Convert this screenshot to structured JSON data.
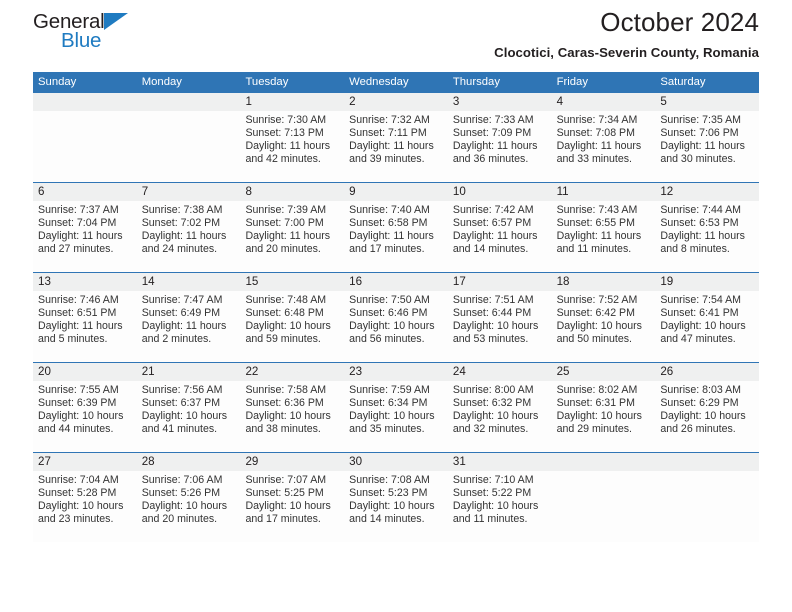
{
  "logo": {
    "text_top": "General",
    "text_bottom": "Blue",
    "color_dark": "#231f20",
    "color_blue": "#1f7bc1"
  },
  "header": {
    "title": "October 2024",
    "subtitle": "Clocotici, Caras-Severin County, Romania"
  },
  "theme": {
    "header_blue": "#2f75b5",
    "date_band": "#eff0f0",
    "cell_bg": "#fdfdfd",
    "text": "#231f20"
  },
  "weekdays": [
    "Sunday",
    "Monday",
    "Tuesday",
    "Wednesday",
    "Thursday",
    "Friday",
    "Saturday"
  ],
  "labels": {
    "sunrise": "Sunrise:",
    "sunset": "Sunset:",
    "daylight": "Daylight:"
  },
  "weeks": [
    [
      {
        "day": "",
        "lines": []
      },
      {
        "day": "",
        "lines": []
      },
      {
        "day": "1",
        "lines": [
          "Sunrise: 7:30 AM",
          "Sunset: 7:13 PM",
          "Daylight: 11 hours",
          "and 42 minutes."
        ]
      },
      {
        "day": "2",
        "lines": [
          "Sunrise: 7:32 AM",
          "Sunset: 7:11 PM",
          "Daylight: 11 hours",
          "and 39 minutes."
        ]
      },
      {
        "day": "3",
        "lines": [
          "Sunrise: 7:33 AM",
          "Sunset: 7:09 PM",
          "Daylight: 11 hours",
          "and 36 minutes."
        ]
      },
      {
        "day": "4",
        "lines": [
          "Sunrise: 7:34 AM",
          "Sunset: 7:08 PM",
          "Daylight: 11 hours",
          "and 33 minutes."
        ]
      },
      {
        "day": "5",
        "lines": [
          "Sunrise: 7:35 AM",
          "Sunset: 7:06 PM",
          "Daylight: 11 hours",
          "and 30 minutes."
        ]
      }
    ],
    [
      {
        "day": "6",
        "lines": [
          "Sunrise: 7:37 AM",
          "Sunset: 7:04 PM",
          "Daylight: 11 hours",
          "and 27 minutes."
        ]
      },
      {
        "day": "7",
        "lines": [
          "Sunrise: 7:38 AM",
          "Sunset: 7:02 PM",
          "Daylight: 11 hours",
          "and 24 minutes."
        ]
      },
      {
        "day": "8",
        "lines": [
          "Sunrise: 7:39 AM",
          "Sunset: 7:00 PM",
          "Daylight: 11 hours",
          "and 20 minutes."
        ]
      },
      {
        "day": "9",
        "lines": [
          "Sunrise: 7:40 AM",
          "Sunset: 6:58 PM",
          "Daylight: 11 hours",
          "and 17 minutes."
        ]
      },
      {
        "day": "10",
        "lines": [
          "Sunrise: 7:42 AM",
          "Sunset: 6:57 PM",
          "Daylight: 11 hours",
          "and 14 minutes."
        ]
      },
      {
        "day": "11",
        "lines": [
          "Sunrise: 7:43 AM",
          "Sunset: 6:55 PM",
          "Daylight: 11 hours",
          "and 11 minutes."
        ]
      },
      {
        "day": "12",
        "lines": [
          "Sunrise: 7:44 AM",
          "Sunset: 6:53 PM",
          "Daylight: 11 hours",
          "and 8 minutes."
        ]
      }
    ],
    [
      {
        "day": "13",
        "lines": [
          "Sunrise: 7:46 AM",
          "Sunset: 6:51 PM",
          "Daylight: 11 hours",
          "and 5 minutes."
        ]
      },
      {
        "day": "14",
        "lines": [
          "Sunrise: 7:47 AM",
          "Sunset: 6:49 PM",
          "Daylight: 11 hours",
          "and 2 minutes."
        ]
      },
      {
        "day": "15",
        "lines": [
          "Sunrise: 7:48 AM",
          "Sunset: 6:48 PM",
          "Daylight: 10 hours",
          "and 59 minutes."
        ]
      },
      {
        "day": "16",
        "lines": [
          "Sunrise: 7:50 AM",
          "Sunset: 6:46 PM",
          "Daylight: 10 hours",
          "and 56 minutes."
        ]
      },
      {
        "day": "17",
        "lines": [
          "Sunrise: 7:51 AM",
          "Sunset: 6:44 PM",
          "Daylight: 10 hours",
          "and 53 minutes."
        ]
      },
      {
        "day": "18",
        "lines": [
          "Sunrise: 7:52 AM",
          "Sunset: 6:42 PM",
          "Daylight: 10 hours",
          "and 50 minutes."
        ]
      },
      {
        "day": "19",
        "lines": [
          "Sunrise: 7:54 AM",
          "Sunset: 6:41 PM",
          "Daylight: 10 hours",
          "and 47 minutes."
        ]
      }
    ],
    [
      {
        "day": "20",
        "lines": [
          "Sunrise: 7:55 AM",
          "Sunset: 6:39 PM",
          "Daylight: 10 hours",
          "and 44 minutes."
        ]
      },
      {
        "day": "21",
        "lines": [
          "Sunrise: 7:56 AM",
          "Sunset: 6:37 PM",
          "Daylight: 10 hours",
          "and 41 minutes."
        ]
      },
      {
        "day": "22",
        "lines": [
          "Sunrise: 7:58 AM",
          "Sunset: 6:36 PM",
          "Daylight: 10 hours",
          "and 38 minutes."
        ]
      },
      {
        "day": "23",
        "lines": [
          "Sunrise: 7:59 AM",
          "Sunset: 6:34 PM",
          "Daylight: 10 hours",
          "and 35 minutes."
        ]
      },
      {
        "day": "24",
        "lines": [
          "Sunrise: 8:00 AM",
          "Sunset: 6:32 PM",
          "Daylight: 10 hours",
          "and 32 minutes."
        ]
      },
      {
        "day": "25",
        "lines": [
          "Sunrise: 8:02 AM",
          "Sunset: 6:31 PM",
          "Daylight: 10 hours",
          "and 29 minutes."
        ]
      },
      {
        "day": "26",
        "lines": [
          "Sunrise: 8:03 AM",
          "Sunset: 6:29 PM",
          "Daylight: 10 hours",
          "and 26 minutes."
        ]
      }
    ],
    [
      {
        "day": "27",
        "lines": [
          "Sunrise: 7:04 AM",
          "Sunset: 5:28 PM",
          "Daylight: 10 hours",
          "and 23 minutes."
        ]
      },
      {
        "day": "28",
        "lines": [
          "Sunrise: 7:06 AM",
          "Sunset: 5:26 PM",
          "Daylight: 10 hours",
          "and 20 minutes."
        ]
      },
      {
        "day": "29",
        "lines": [
          "Sunrise: 7:07 AM",
          "Sunset: 5:25 PM",
          "Daylight: 10 hours",
          "and 17 minutes."
        ]
      },
      {
        "day": "30",
        "lines": [
          "Sunrise: 7:08 AM",
          "Sunset: 5:23 PM",
          "Daylight: 10 hours",
          "and 14 minutes."
        ]
      },
      {
        "day": "31",
        "lines": [
          "Sunrise: 7:10 AM",
          "Sunset: 5:22 PM",
          "Daylight: 10 hours",
          "and 11 minutes."
        ]
      },
      {
        "day": "",
        "lines": []
      },
      {
        "day": "",
        "lines": []
      }
    ]
  ]
}
